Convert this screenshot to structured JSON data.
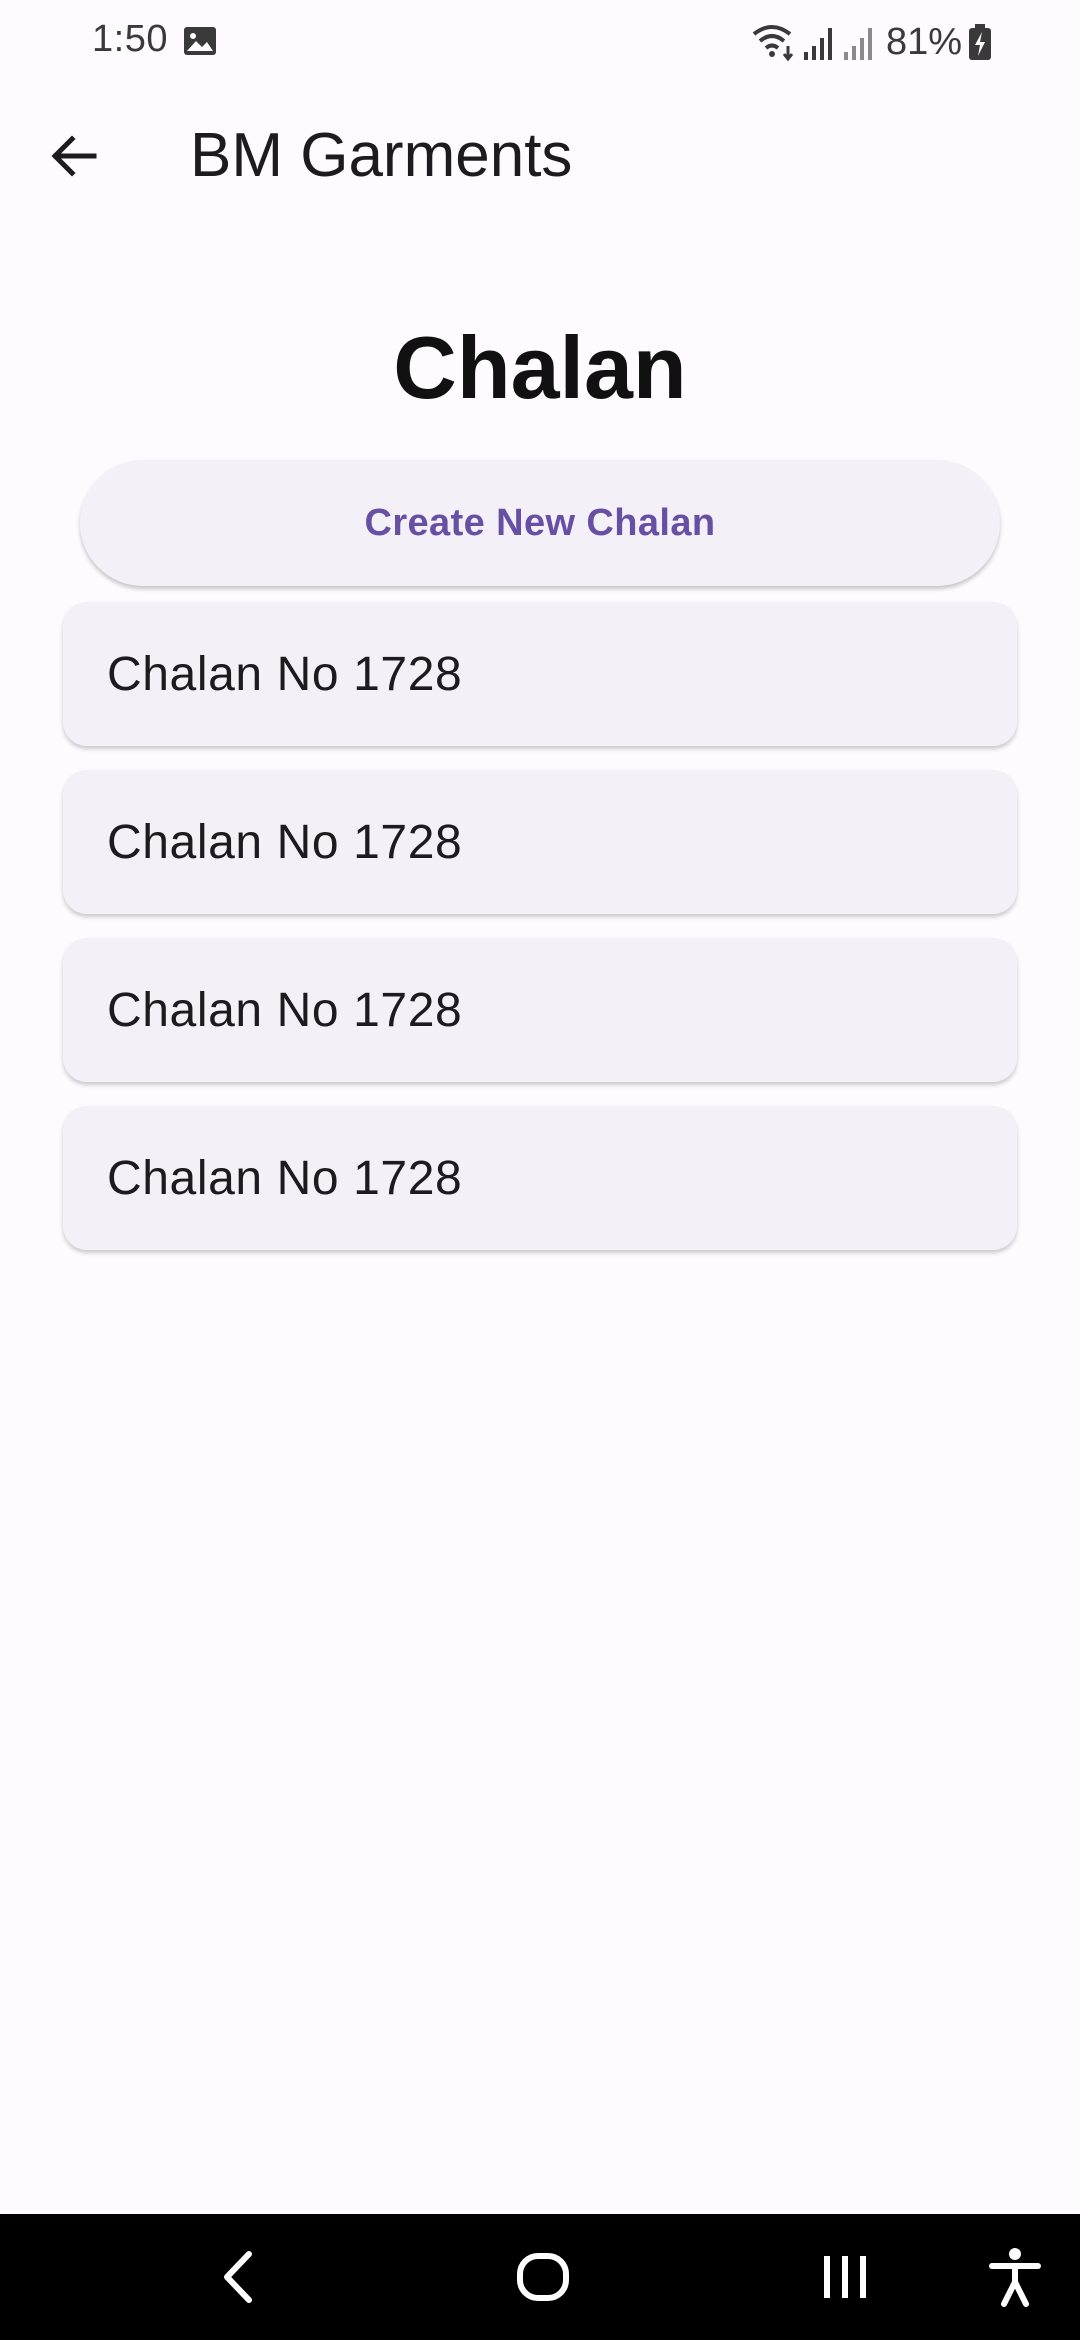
{
  "status_bar": {
    "time": "1:50",
    "battery": "81%",
    "icons": [
      "gallery-icon",
      "wifi-icon",
      "signal-icon",
      "signal-icon",
      "battery-charging-icon"
    ]
  },
  "app_bar": {
    "title": "BM Garments",
    "back_icon": "arrow-back-icon"
  },
  "page": {
    "heading": "Chalan",
    "create_button_label": "Create New Chalan"
  },
  "chalans": [
    {
      "label": "Chalan No 1728"
    },
    {
      "label": "Chalan No 1728"
    },
    {
      "label": "Chalan No 1728"
    },
    {
      "label": "Chalan No 1728"
    }
  ],
  "nav_bar": {
    "icons": [
      "nav-back-icon",
      "nav-home-icon",
      "nav-recents-icon",
      "accessibility-icon"
    ]
  },
  "colors": {
    "background": "#fefbfe",
    "card": "#f4f0f7",
    "accent": "#6750a4",
    "nav_bar": "#000000"
  }
}
